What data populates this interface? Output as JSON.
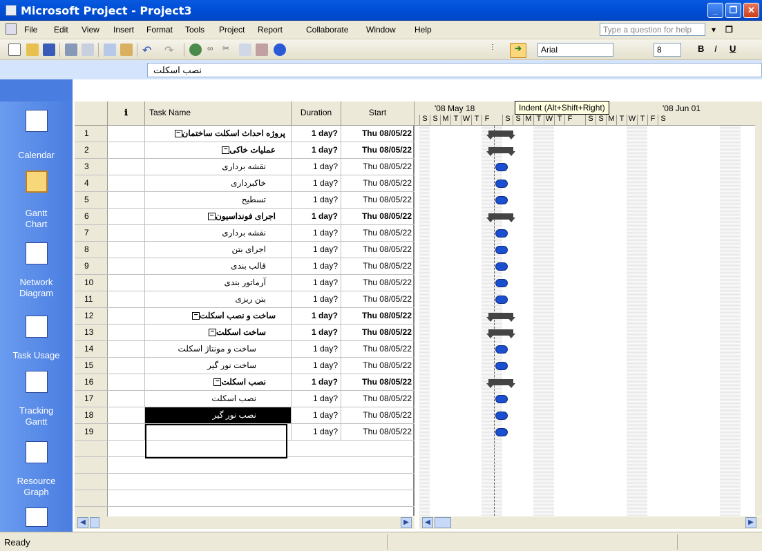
{
  "window": {
    "title": "Microsoft Project - Project3"
  },
  "menu": [
    "File",
    "Edit",
    "View",
    "Insert",
    "Format",
    "Tools",
    "Project",
    "Report",
    "Collaborate",
    "Window",
    "Help"
  ],
  "help_placeholder": "Type a question for help",
  "toolbar": {
    "font": "Arial",
    "size": "8",
    "bold": "B",
    "italic": "I",
    "underline": "U"
  },
  "entry": {
    "value": "نصب اسکلت"
  },
  "tooltip": "Indent (Alt+Shift+Right)",
  "views": [
    "Calendar",
    "Gantt Chart",
    "Network Diagram",
    "Task Usage",
    "Tracking Gantt",
    "Resource Graph"
  ],
  "columns": {
    "name": "Task Name",
    "duration": "Duration",
    "start": "Start"
  },
  "timescale": {
    "weeks": [
      "'08 May 18",
      "'08 Jun 01"
    ],
    "days": [
      "S",
      "S",
      "M",
      "T",
      "W",
      "T",
      "F",
      "S",
      "S",
      "M",
      "T",
      "W",
      "T",
      "F",
      "S",
      "S",
      "M",
      "T",
      "W",
      "T",
      "F",
      "S"
    ]
  },
  "tasks": [
    {
      "id": "1",
      "name": "پروژه احداث اسکلت ساختمان",
      "duration": "1 day?",
      "start": "Thu 08/05/22",
      "summary": true
    },
    {
      "id": "2",
      "name": "عملیات خاکی",
      "duration": "1 day?",
      "start": "Thu 08/05/22",
      "summary": true
    },
    {
      "id": "3",
      "name": "نقشه برداری",
      "duration": "1 day?",
      "start": "Thu 08/05/22",
      "summary": false
    },
    {
      "id": "4",
      "name": "خاکبرداری",
      "duration": "1 day?",
      "start": "Thu 08/05/22",
      "summary": false
    },
    {
      "id": "5",
      "name": "تسطیح",
      "duration": "1 day?",
      "start": "Thu 08/05/22",
      "summary": false
    },
    {
      "id": "6",
      "name": "اجرای فونداسیون",
      "duration": "1 day?",
      "start": "Thu 08/05/22",
      "summary": true
    },
    {
      "id": "7",
      "name": "نقشه برداری",
      "duration": "1 day?",
      "start": "Thu 08/05/22",
      "summary": false
    },
    {
      "id": "8",
      "name": "اجرای بتن",
      "duration": "1 day?",
      "start": "Thu 08/05/22",
      "summary": false
    },
    {
      "id": "9",
      "name": "قالب بندی",
      "duration": "1 day?",
      "start": "Thu 08/05/22",
      "summary": false
    },
    {
      "id": "10",
      "name": "آرماتور بندی",
      "duration": "1 day?",
      "start": "Thu 08/05/22",
      "summary": false
    },
    {
      "id": "11",
      "name": "بتن ریزی",
      "duration": "1 day?",
      "start": "Thu 08/05/22",
      "summary": false
    },
    {
      "id": "12",
      "name": "ساخت و نصب اسکلت",
      "duration": "1 day?",
      "start": "Thu 08/05/22",
      "summary": true
    },
    {
      "id": "13",
      "name": "ساخت اسکلت",
      "duration": "1 day?",
      "start": "Thu 08/05/22",
      "summary": true
    },
    {
      "id": "14",
      "name": "ساخت و مونتاژ اسکلت",
      "duration": "1 day?",
      "start": "Thu 08/05/22",
      "summary": false
    },
    {
      "id": "15",
      "name": "ساخت نور گیر",
      "duration": "1 day?",
      "start": "Thu 08/05/22",
      "summary": false
    },
    {
      "id": "16",
      "name": "نصب اسکلت",
      "duration": "1 day?",
      "start": "Thu 08/05/22",
      "summary": true
    },
    {
      "id": "17",
      "name": "نصب اسکلت",
      "duration": "1 day?",
      "start": "Thu 08/05/22",
      "summary": false
    },
    {
      "id": "18",
      "name": "نصب نور گیر",
      "duration": "1 day?",
      "start": "Thu 08/05/22",
      "summary": false
    },
    {
      "id": "19",
      "name": "",
      "duration": "1 day?",
      "start": "Thu 08/05/22",
      "summary": false
    }
  ],
  "status": "Ready"
}
